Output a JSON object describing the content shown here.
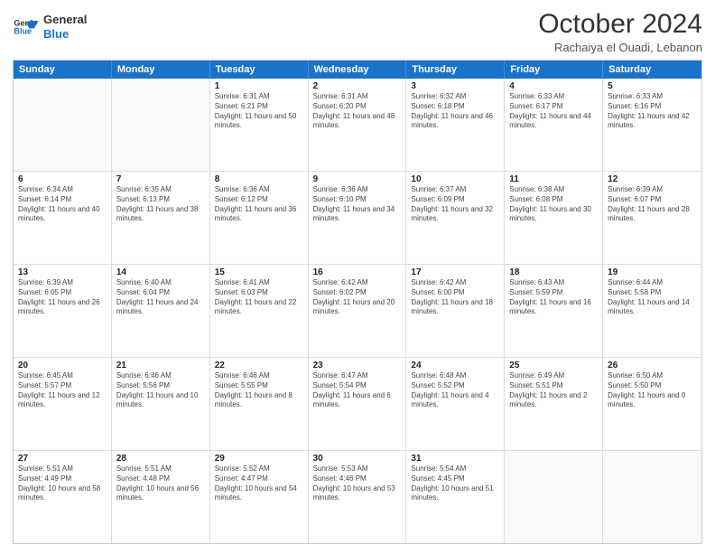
{
  "logo": {
    "line1": "General",
    "line2": "Blue"
  },
  "title": "October 2024",
  "subtitle": "Rachaiya el Ouadi, Lebanon",
  "days_of_week": [
    "Sunday",
    "Monday",
    "Tuesday",
    "Wednesday",
    "Thursday",
    "Friday",
    "Saturday"
  ],
  "weeks": [
    [
      {
        "day": "",
        "sunrise": "",
        "sunset": "",
        "daylight": ""
      },
      {
        "day": "",
        "sunrise": "",
        "sunset": "",
        "daylight": ""
      },
      {
        "day": "1",
        "sunrise": "Sunrise: 6:31 AM",
        "sunset": "Sunset: 6:21 PM",
        "daylight": "Daylight: 11 hours and 50 minutes."
      },
      {
        "day": "2",
        "sunrise": "Sunrise: 6:31 AM",
        "sunset": "Sunset: 6:20 PM",
        "daylight": "Daylight: 11 hours and 48 minutes."
      },
      {
        "day": "3",
        "sunrise": "Sunrise: 6:32 AM",
        "sunset": "Sunset: 6:18 PM",
        "daylight": "Daylight: 11 hours and 46 minutes."
      },
      {
        "day": "4",
        "sunrise": "Sunrise: 6:33 AM",
        "sunset": "Sunset: 6:17 PM",
        "daylight": "Daylight: 11 hours and 44 minutes."
      },
      {
        "day": "5",
        "sunrise": "Sunrise: 6:33 AM",
        "sunset": "Sunset: 6:16 PM",
        "daylight": "Daylight: 11 hours and 42 minutes."
      }
    ],
    [
      {
        "day": "6",
        "sunrise": "Sunrise: 6:34 AM",
        "sunset": "Sunset: 6:14 PM",
        "daylight": "Daylight: 11 hours and 40 minutes."
      },
      {
        "day": "7",
        "sunrise": "Sunrise: 6:35 AM",
        "sunset": "Sunset: 6:13 PM",
        "daylight": "Daylight: 11 hours and 38 minutes."
      },
      {
        "day": "8",
        "sunrise": "Sunrise: 6:36 AM",
        "sunset": "Sunset: 6:12 PM",
        "daylight": "Daylight: 11 hours and 36 minutes."
      },
      {
        "day": "9",
        "sunrise": "Sunrise: 6:36 AM",
        "sunset": "Sunset: 6:10 PM",
        "daylight": "Daylight: 11 hours and 34 minutes."
      },
      {
        "day": "10",
        "sunrise": "Sunrise: 6:37 AM",
        "sunset": "Sunset: 6:09 PM",
        "daylight": "Daylight: 11 hours and 32 minutes."
      },
      {
        "day": "11",
        "sunrise": "Sunrise: 6:38 AM",
        "sunset": "Sunset: 6:08 PM",
        "daylight": "Daylight: 11 hours and 30 minutes."
      },
      {
        "day": "12",
        "sunrise": "Sunrise: 6:39 AM",
        "sunset": "Sunset: 6:07 PM",
        "daylight": "Daylight: 11 hours and 28 minutes."
      }
    ],
    [
      {
        "day": "13",
        "sunrise": "Sunrise: 6:39 AM",
        "sunset": "Sunset: 6:05 PM",
        "daylight": "Daylight: 11 hours and 26 minutes."
      },
      {
        "day": "14",
        "sunrise": "Sunrise: 6:40 AM",
        "sunset": "Sunset: 6:04 PM",
        "daylight": "Daylight: 11 hours and 24 minutes."
      },
      {
        "day": "15",
        "sunrise": "Sunrise: 6:41 AM",
        "sunset": "Sunset: 6:03 PM",
        "daylight": "Daylight: 11 hours and 22 minutes."
      },
      {
        "day": "16",
        "sunrise": "Sunrise: 6:42 AM",
        "sunset": "Sunset: 6:02 PM",
        "daylight": "Daylight: 11 hours and 20 minutes."
      },
      {
        "day": "17",
        "sunrise": "Sunrise: 6:42 AM",
        "sunset": "Sunset: 6:00 PM",
        "daylight": "Daylight: 11 hours and 18 minutes."
      },
      {
        "day": "18",
        "sunrise": "Sunrise: 6:43 AM",
        "sunset": "Sunset: 5:59 PM",
        "daylight": "Daylight: 11 hours and 16 minutes."
      },
      {
        "day": "19",
        "sunrise": "Sunrise: 6:44 AM",
        "sunset": "Sunset: 5:58 PM",
        "daylight": "Daylight: 11 hours and 14 minutes."
      }
    ],
    [
      {
        "day": "20",
        "sunrise": "Sunrise: 6:45 AM",
        "sunset": "Sunset: 5:57 PM",
        "daylight": "Daylight: 11 hours and 12 minutes."
      },
      {
        "day": "21",
        "sunrise": "Sunrise: 6:46 AM",
        "sunset": "Sunset: 5:56 PM",
        "daylight": "Daylight: 11 hours and 10 minutes."
      },
      {
        "day": "22",
        "sunrise": "Sunrise: 6:46 AM",
        "sunset": "Sunset: 5:55 PM",
        "daylight": "Daylight: 11 hours and 8 minutes."
      },
      {
        "day": "23",
        "sunrise": "Sunrise: 6:47 AM",
        "sunset": "Sunset: 5:54 PM",
        "daylight": "Daylight: 11 hours and 6 minutes."
      },
      {
        "day": "24",
        "sunrise": "Sunrise: 6:48 AM",
        "sunset": "Sunset: 5:52 PM",
        "daylight": "Daylight: 11 hours and 4 minutes."
      },
      {
        "day": "25",
        "sunrise": "Sunrise: 6:49 AM",
        "sunset": "Sunset: 5:51 PM",
        "daylight": "Daylight: 11 hours and 2 minutes."
      },
      {
        "day": "26",
        "sunrise": "Sunrise: 6:50 AM",
        "sunset": "Sunset: 5:50 PM",
        "daylight": "Daylight: 11 hours and 0 minutes."
      }
    ],
    [
      {
        "day": "27",
        "sunrise": "Sunrise: 5:51 AM",
        "sunset": "Sunset: 4:49 PM",
        "daylight": "Daylight: 10 hours and 58 minutes."
      },
      {
        "day": "28",
        "sunrise": "Sunrise: 5:51 AM",
        "sunset": "Sunset: 4:48 PM",
        "daylight": "Daylight: 10 hours and 56 minutes."
      },
      {
        "day": "29",
        "sunrise": "Sunrise: 5:52 AM",
        "sunset": "Sunset: 4:47 PM",
        "daylight": "Daylight: 10 hours and 54 minutes."
      },
      {
        "day": "30",
        "sunrise": "Sunrise: 5:53 AM",
        "sunset": "Sunset: 4:46 PM",
        "daylight": "Daylight: 10 hours and 53 minutes."
      },
      {
        "day": "31",
        "sunrise": "Sunrise: 5:54 AM",
        "sunset": "Sunset: 4:45 PM",
        "daylight": "Daylight: 10 hours and 51 minutes."
      },
      {
        "day": "",
        "sunrise": "",
        "sunset": "",
        "daylight": ""
      },
      {
        "day": "",
        "sunrise": "",
        "sunset": "",
        "daylight": ""
      }
    ]
  ]
}
